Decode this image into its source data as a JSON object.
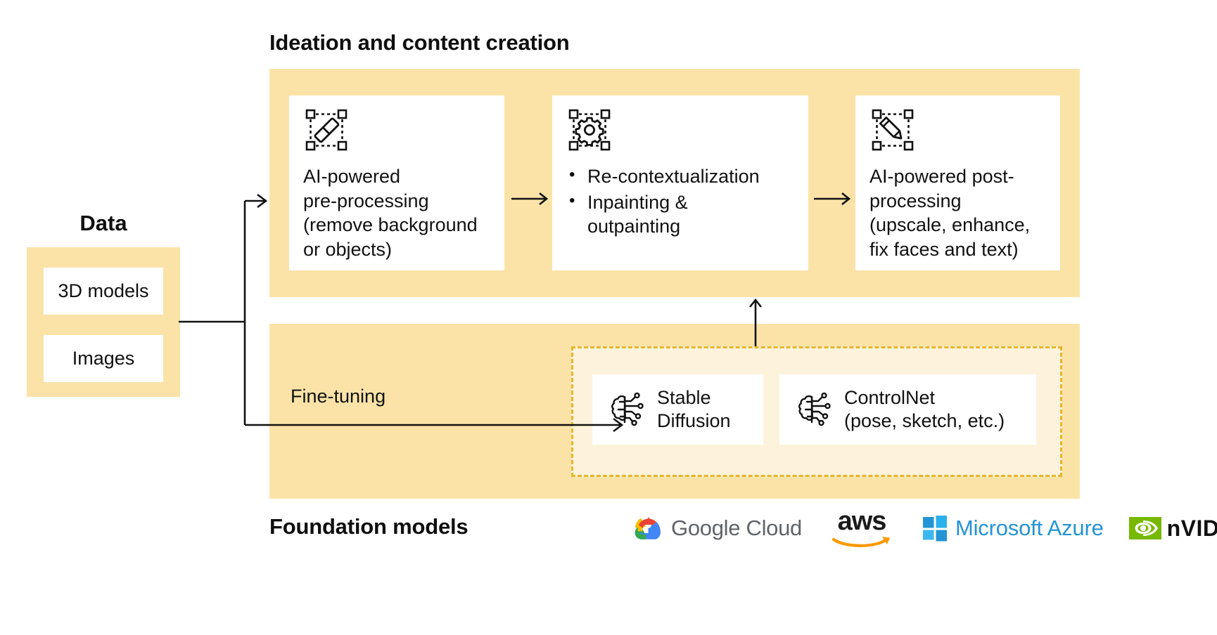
{
  "diagram": {
    "headings": {
      "top_section": "Ideation and content creation",
      "bottom_section": "Foundation models",
      "data_title": "Data"
    },
    "data_block": {
      "items": [
        {
          "label": "3D models"
        },
        {
          "label": "Images"
        }
      ]
    },
    "pipeline": {
      "steps": [
        {
          "icon": "selection-eraser-icon",
          "text": "AI-powered pre-processing (remove background or objects)",
          "lines": [
            "AI-powered",
            "pre-processing",
            "(remove background",
            "or objects)"
          ]
        },
        {
          "icon": "selection-gear-icon",
          "text": "Re-contextualization; Inpainting & outpainting",
          "bullets": [
            {
              "lines": [
                "Re-contextualization"
              ]
            },
            {
              "lines": [
                "Inpainting &",
                "outpainting"
              ]
            }
          ]
        },
        {
          "icon": "selection-pencil-icon",
          "text": "AI-powered post-processing (upscale, enhance, fix faces and text)",
          "lines": [
            "AI-powered post-",
            "processing",
            "(upscale, enhance,",
            "fix faces and text)"
          ]
        }
      ]
    },
    "fine_tuning": {
      "label": "Fine-tuning"
    },
    "models": [
      {
        "icon": "ai-brain-circuit-icon",
        "lines": [
          "Stable",
          "Diffusion"
        ]
      },
      {
        "icon": "ai-brain-circuit-icon",
        "lines": [
          "ControlNet",
          "(pose, sketch, etc.)"
        ]
      }
    ],
    "logos": [
      {
        "name": "google-cloud-logo",
        "text_bold": "Google",
        "text_light": "Cloud"
      },
      {
        "name": "aws-logo",
        "text": "aws"
      },
      {
        "name": "microsoft-azure-logo",
        "text": "Microsoft Azure"
      },
      {
        "name": "nvidia-logo",
        "text": "nVIDIA"
      }
    ],
    "colors": {
      "panel_fill": "#fbe3a8",
      "dashed_border": "#e8b52a",
      "dashed_fill": "#fdf3dc",
      "card_fill": "#ffffff",
      "text": "#111111",
      "azure_blue": "#2394d4",
      "nvidia_green": "#76b900",
      "aws_orange": "#ff9900"
    }
  }
}
